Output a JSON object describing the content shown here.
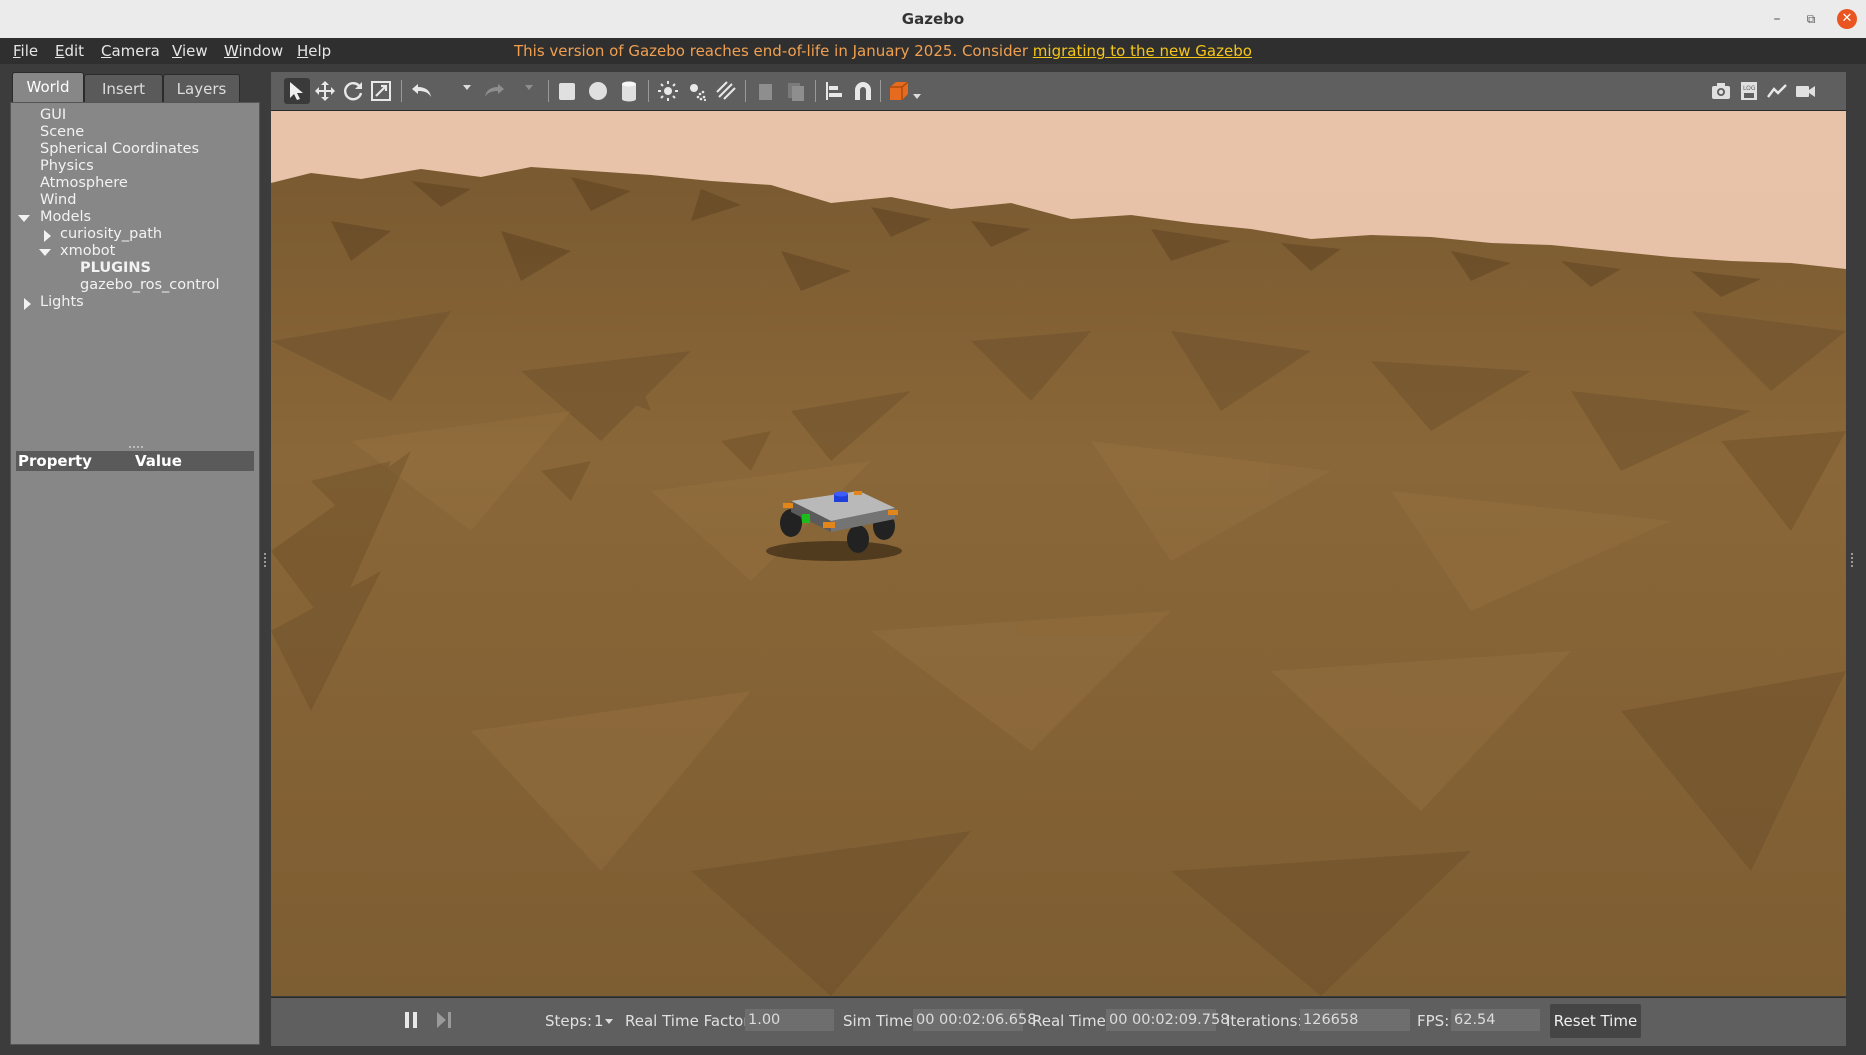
{
  "window": {
    "title": "Gazebo"
  },
  "menu": {
    "items": [
      "File",
      "Edit",
      "Camera",
      "View",
      "Window",
      "Help"
    ],
    "eol_text": "This version of Gazebo reaches end-of-life in January 2025. Consider ",
    "eol_link": "migrating to the new Gazebo"
  },
  "left_panel": {
    "tabs": [
      "World",
      "Insert",
      "Layers"
    ],
    "active_tab": "World",
    "tree": {
      "gui": "GUI",
      "scene": "Scene",
      "spherical": "Spherical Coordinates",
      "physics": "Physics",
      "atmosphere": "Atmosphere",
      "wind": "Wind",
      "models": "Models",
      "curiosity_path": "curiosity_path",
      "xmobot": "xmobot",
      "plugins": "PLUGINS",
      "ros_control": "gazebo_ros_control",
      "lights": "Lights"
    },
    "property_header": {
      "property": "Property",
      "value": "Value"
    }
  },
  "toolbar": {
    "icons": [
      "select-mode",
      "translate-mode",
      "rotate-mode",
      "scale-mode",
      "undo",
      "redo",
      "box-shape",
      "sphere-shape",
      "cylinder-shape",
      "point-light",
      "spot-light",
      "directional-light",
      "copy",
      "paste",
      "align",
      "snap",
      "change-view",
      "screenshot",
      "log",
      "plot",
      "video-record"
    ]
  },
  "bottom_bar": {
    "steps_label": "Steps:",
    "steps_value": "1",
    "rtf_label": "Real Time Factor:",
    "rtf_value": "1.00",
    "sim_time_label": "Sim Time:",
    "sim_time_value": "00 00:02:06.658",
    "real_time_label": "Real Time:",
    "real_time_value": "00 00:02:09.758",
    "iterations_label": "Iterations:",
    "iterations_value": "126658",
    "fps_label": "FPS:",
    "fps_value": "62.54",
    "reset_label": "Reset Time"
  },
  "colors": {
    "sky": "#e6c2a8",
    "terrain": "#8a6534",
    "eol_text": "#f0a050",
    "eol_link": "#f5c518"
  }
}
